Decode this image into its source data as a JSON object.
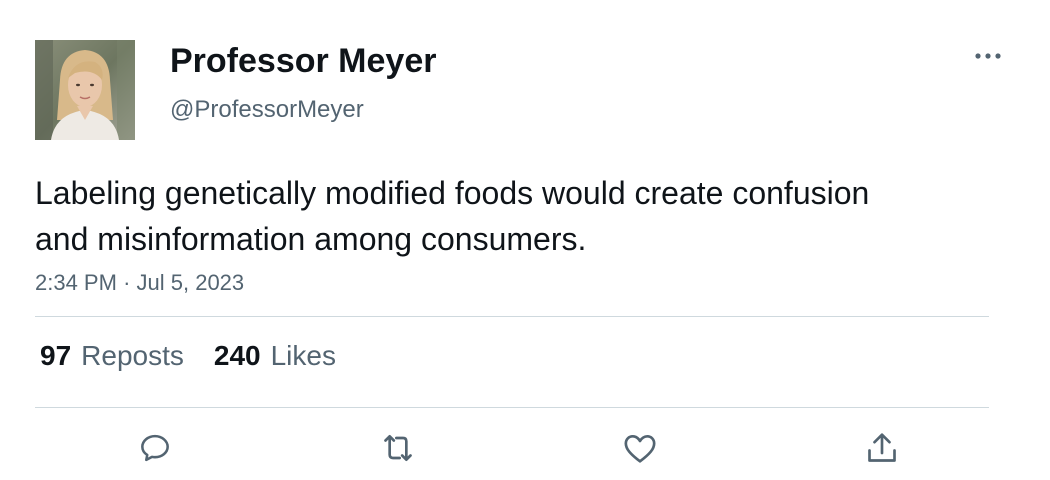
{
  "author": {
    "display_name": "Professor Meyer",
    "handle": "@ProfessorMeyer",
    "avatar_icon": "profile-photo"
  },
  "tweet": {
    "text": "Labeling genetically modified foods would create confusion and misinformation among consumers.",
    "time": "2:34 PM",
    "separator": "·",
    "date": "Jul 5, 2023"
  },
  "stats": {
    "reposts_count": "97",
    "reposts_label": "Reposts",
    "likes_count": "240",
    "likes_label": "Likes"
  },
  "actions": {
    "reply_icon": "reply-icon",
    "repost_icon": "repost-icon",
    "like_icon": "like-icon",
    "share_icon": "share-icon"
  },
  "colors": {
    "text_primary": "#0f1419",
    "text_secondary": "#536471",
    "divider": "#cfd9de"
  }
}
